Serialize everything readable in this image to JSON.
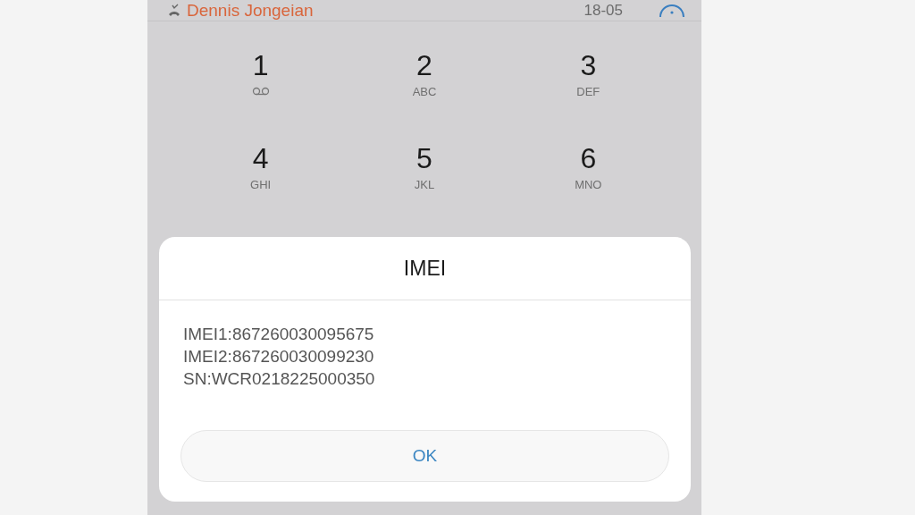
{
  "call_log_entry": {
    "name": "Dennis Jongeian",
    "time": "18-05",
    "missed": true
  },
  "keypad": [
    {
      "digit": "1",
      "kind": "voicemail"
    },
    {
      "digit": "2",
      "kind": "letters",
      "letters": "ABC"
    },
    {
      "digit": "3",
      "kind": "letters",
      "letters": "DEF"
    },
    {
      "digit": "4",
      "kind": "letters",
      "letters": "GHI"
    },
    {
      "digit": "5",
      "kind": "letters",
      "letters": "JKL"
    },
    {
      "digit": "6",
      "kind": "letters",
      "letters": "MNO"
    }
  ],
  "dialog": {
    "title": "IMEI",
    "lines": [
      "IMEI1:867260030095675",
      "IMEI2:867260030099230",
      "SN:WCR0218225000350"
    ],
    "button": "OK"
  }
}
